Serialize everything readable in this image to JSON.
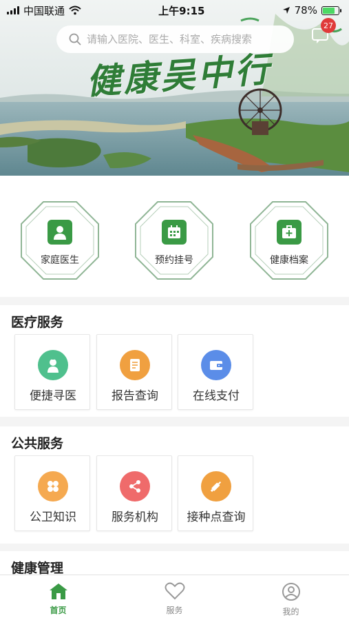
{
  "status_bar": {
    "carrier": "中国联通",
    "time": "上午9:15",
    "battery": "78%",
    "battery_level": 0.78
  },
  "banner": {
    "title": "健康吴中行"
  },
  "search": {
    "placeholder": "请输入医院、医生、科室、疾病搜索"
  },
  "messages": {
    "badge_count": "27"
  },
  "quick_entries": [
    {
      "label": "家庭医生",
      "icon": "doctor-icon"
    },
    {
      "label": "预约挂号",
      "icon": "calendar-icon"
    },
    {
      "label": "健康档案",
      "icon": "medical-kit-icon"
    }
  ],
  "medical_services": {
    "title": "医疗服务",
    "items": [
      {
        "label": "便捷寻医",
        "icon": "nurse-icon",
        "color": "#4fc08d"
      },
      {
        "label": "报告查询",
        "icon": "report-icon",
        "color": "#f0a040"
      },
      {
        "label": "在线支付",
        "icon": "wallet-icon",
        "color": "#5b8de8"
      }
    ]
  },
  "public_services": {
    "title": "公共服务",
    "items": [
      {
        "label": "公卫知识",
        "icon": "grid-icon",
        "color": "#f5a950"
      },
      {
        "label": "服务机构",
        "icon": "share-icon",
        "color": "#ef6b6b"
      },
      {
        "label": "接种点查询",
        "icon": "syringe-icon",
        "color": "#f0a040"
      }
    ]
  },
  "health_management": {
    "title": "健康管理"
  },
  "tabbar": {
    "active_color": "#3a9a45",
    "tabs": [
      {
        "label": "首页",
        "icon": "home-icon"
      },
      {
        "label": "服务",
        "icon": "heart-icon"
      },
      {
        "label": "我的",
        "icon": "user-icon"
      }
    ]
  }
}
